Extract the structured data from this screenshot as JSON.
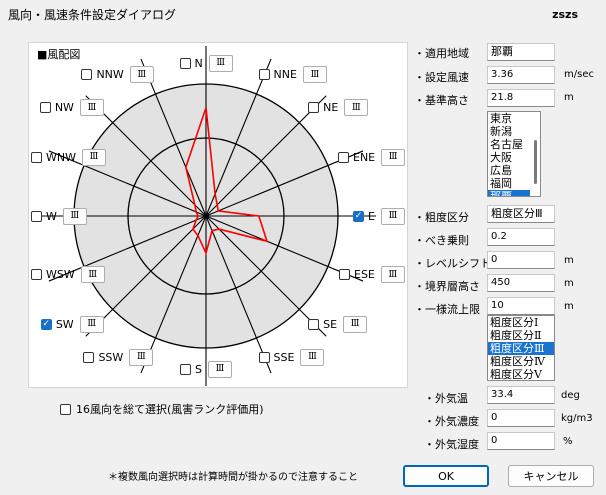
{
  "window": {
    "title": "風向・風速条件設定ダイアログ",
    "right_text": "zszs"
  },
  "rose": {
    "title": "■風配図",
    "directions": [
      {
        "name": "N",
        "checked": false,
        "btn": "Ⅲ"
      },
      {
        "name": "NNE",
        "checked": false,
        "btn": "Ⅲ"
      },
      {
        "name": "NE",
        "checked": false,
        "btn": "Ⅲ"
      },
      {
        "name": "ENE",
        "checked": false,
        "btn": "Ⅲ"
      },
      {
        "name": "E",
        "checked": true,
        "btn": "Ⅲ"
      },
      {
        "name": "ESE",
        "checked": false,
        "btn": "Ⅲ"
      },
      {
        "name": "SE",
        "checked": false,
        "btn": "Ⅲ"
      },
      {
        "name": "SSE",
        "checked": false,
        "btn": "Ⅲ"
      },
      {
        "name": "S",
        "checked": false,
        "btn": "Ⅲ"
      },
      {
        "name": "SSW",
        "checked": false,
        "btn": "Ⅲ"
      },
      {
        "name": "SW",
        "checked": true,
        "btn": "Ⅲ"
      },
      {
        "name": "WSW",
        "checked": false,
        "btn": "Ⅲ"
      },
      {
        "name": "W",
        "checked": false,
        "btn": "Ⅲ"
      },
      {
        "name": "WNW",
        "checked": false,
        "btn": "Ⅲ"
      },
      {
        "name": "NW",
        "checked": false,
        "btn": "Ⅲ"
      },
      {
        "name": "NNW",
        "checked": false,
        "btn": "Ⅲ"
      }
    ],
    "frequency": [
      0.82,
      0.18,
      0.12,
      0.1,
      0.4,
      0.5,
      0.14,
      0.12,
      0.28,
      0.16,
      0.14,
      0.08,
      0.06,
      0.08,
      0.12,
      0.4
    ],
    "outline_color": "#ff0000"
  },
  "params": {
    "area": {
      "label": "・適用地域",
      "value": "那覇"
    },
    "wind_speed": {
      "label": "・設定風速",
      "value": "3.36",
      "unit": "m/sec"
    },
    "ref_height": {
      "label": "・基準高さ",
      "value": "21.8",
      "unit": "m"
    },
    "city_list": {
      "items": [
        "東京",
        "新潟",
        "名古屋",
        "大阪",
        "広島",
        "福岡",
        "那覇"
      ],
      "selected": "那覇"
    },
    "roughness": {
      "label": "・粗度区分",
      "value": "粗度区分Ⅲ"
    },
    "power_law": {
      "label": "・べき乗則",
      "value": "0.2"
    },
    "level_shift": {
      "label": "・レベルシフト",
      "value": "0",
      "unit": "m"
    },
    "boundary_height": {
      "label": "・境界層高さ",
      "value": "450",
      "unit": "m"
    },
    "uniform_limit": {
      "label": "・一様流上限",
      "value": "10",
      "unit": "m"
    },
    "roughness_list": {
      "items": [
        "粗度区分Ⅰ",
        "粗度区分Ⅱ",
        "粗度区分Ⅲ",
        "粗度区分Ⅳ",
        "粗度区分Ⅴ"
      ],
      "selected": "粗度区分Ⅲ"
    },
    "outdoor_temp": {
      "label": "・外気温",
      "value": "33.4",
      "unit": "deg"
    },
    "outdoor_density": {
      "label": "・外気濃度",
      "value": "0",
      "unit": "kg/m3"
    },
    "outdoor_humidity": {
      "label": "・外気湿度",
      "value": "0",
      "unit": "%"
    }
  },
  "select_all": {
    "label": "16風向を総て選択(風害ランク評価用)",
    "checked": false
  },
  "note": "＊複数風向選択時は計算時間が掛かるので注意すること",
  "buttons": {
    "ok": "OK",
    "cancel": "キャンセル"
  }
}
